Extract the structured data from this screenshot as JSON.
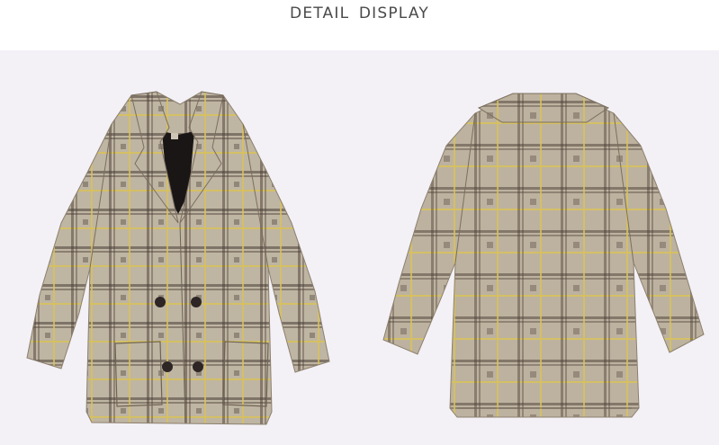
{
  "header": {
    "title": "DETAIL  DISPLAY"
  },
  "photo": {
    "background_color": "#f3f1f6",
    "views": [
      "front",
      "back"
    ],
    "fabric_colors": {
      "base": "#b5aa98",
      "check_dark": "#4a3e36",
      "check_yellow": "#d8c25a",
      "lining": "#1a1616"
    }
  }
}
